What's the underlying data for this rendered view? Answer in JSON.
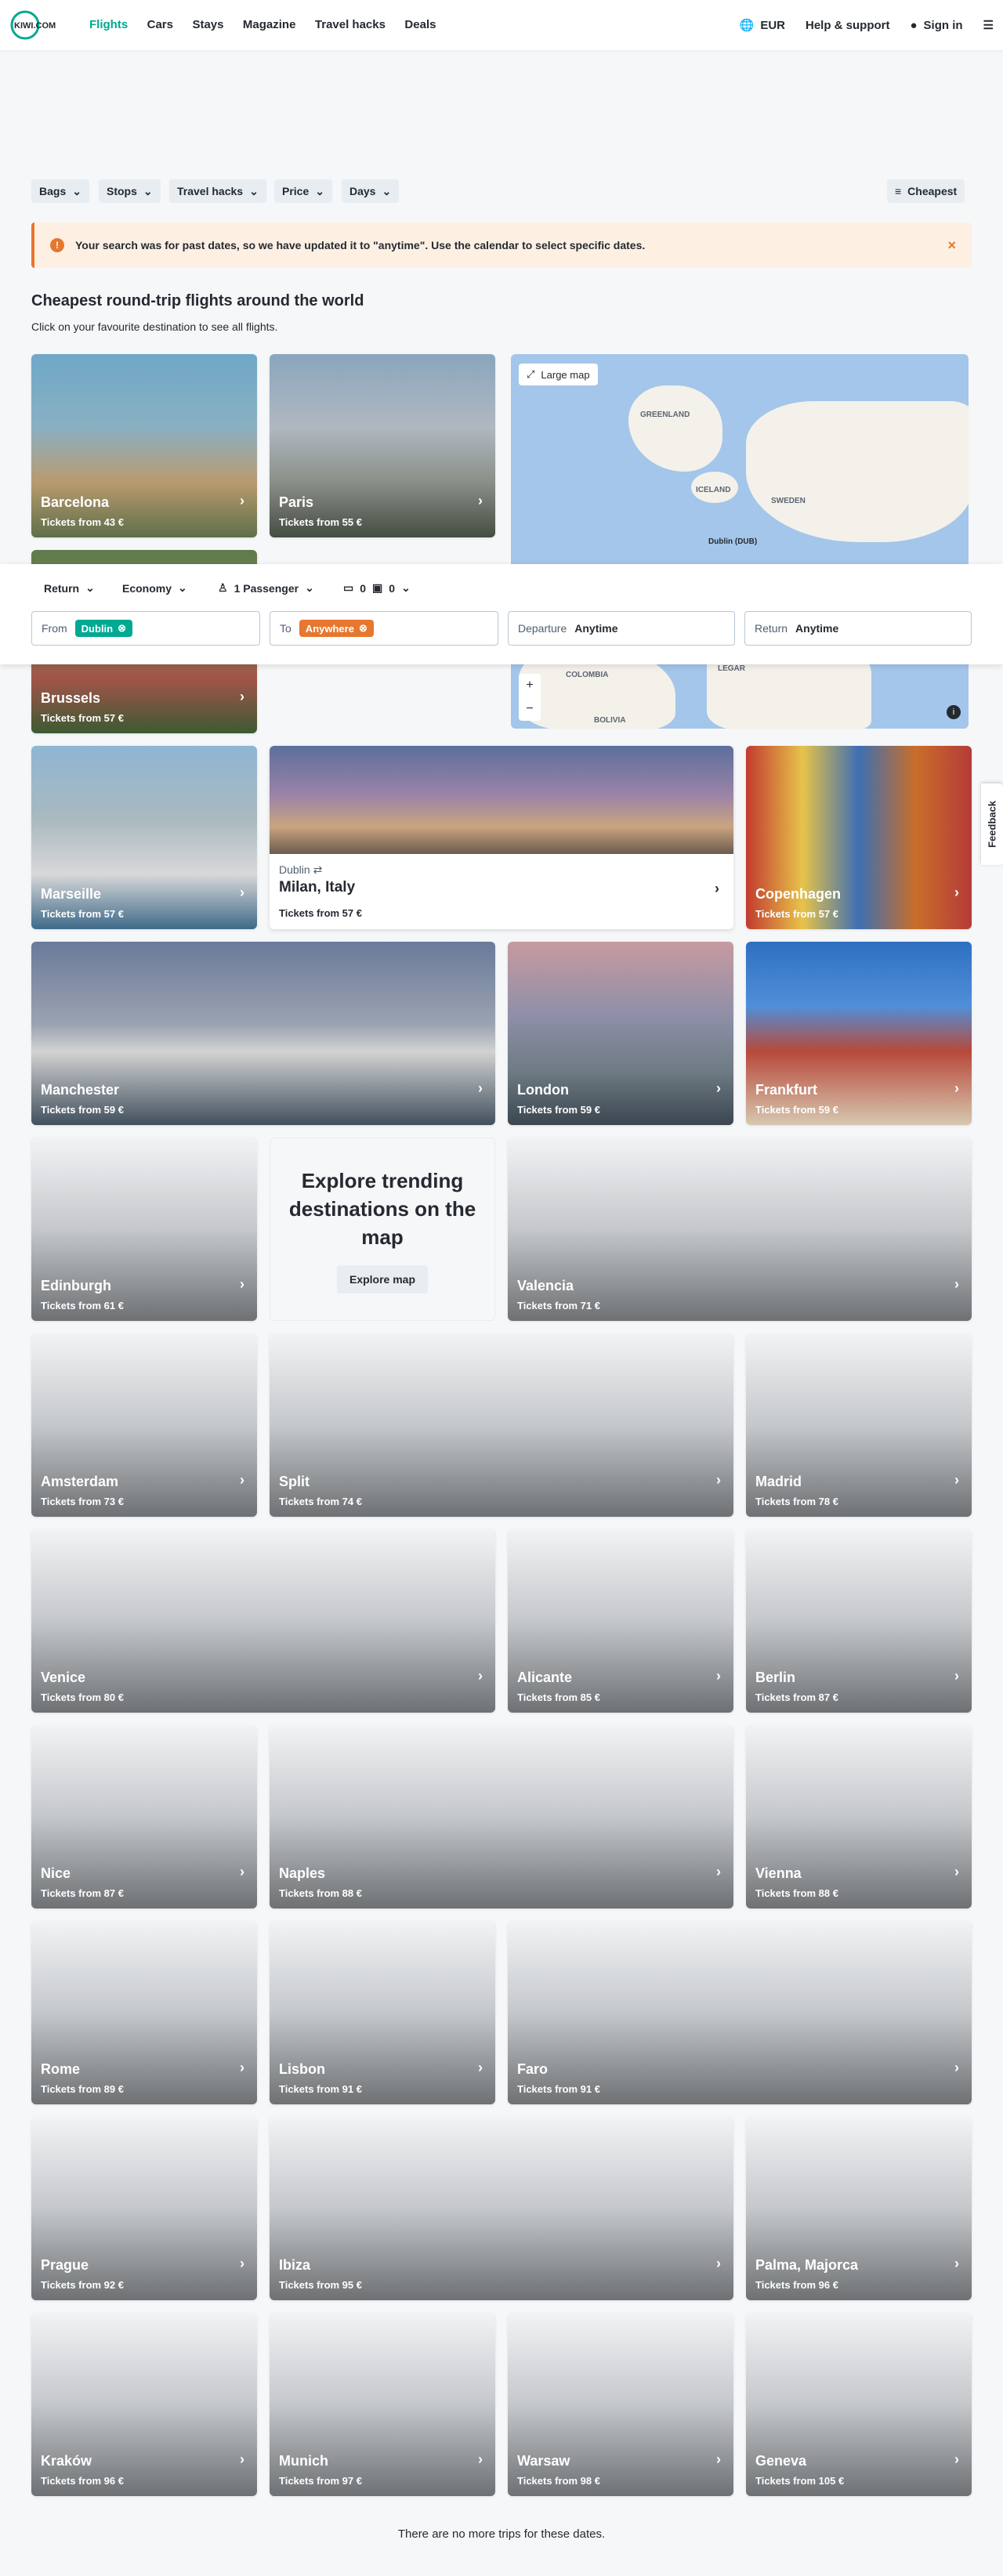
{
  "nav": {
    "logo_text": "KIWI.COM",
    "items": [
      "Flights",
      "Cars",
      "Stays",
      "Magazine",
      "Travel hacks",
      "Deals"
    ],
    "currency": "EUR",
    "help": "Help & support",
    "signin": "Sign in"
  },
  "filters": {
    "items": [
      "Bags",
      "Stops",
      "Travel hacks",
      "Price",
      "Days"
    ],
    "sort": "Cheapest"
  },
  "banner": {
    "text": "Your search was for past dates, so we have updated it to \"anytime\". Use the calendar to select specific dates."
  },
  "heading": "Cheapest round-trip flights around the world",
  "subheading": "Click on your favourite destination to see all flights.",
  "map": {
    "large_map": "Large map",
    "labels": [
      "GREENLAND",
      "ICELAND",
      "SWEDEN",
      "Dublin (DUB)",
      "COLOMBIA",
      "LEGAR",
      "BOLIVIA"
    ]
  },
  "search": {
    "trip_type": "Return",
    "cabin": "Economy",
    "passengers": "1 Passenger",
    "bags_cabin": "0",
    "bags_checked": "0",
    "from_label": "From",
    "from_value": "Dublin",
    "to_label": "To",
    "to_value": "Anywhere",
    "departure_label": "Departure",
    "departure_value": "Anytime",
    "return_label": "Return",
    "return_value": "Anytime"
  },
  "milan": {
    "origin": "Dublin",
    "city": "Milan, Italy",
    "price": "Tickets from 57 €"
  },
  "explore": {
    "title": "Explore trending destinations on the map",
    "button": "Explore map"
  },
  "feedback": "Feedback",
  "destinations": [
    {
      "name": "Barcelona",
      "price": "Tickets from 43 €"
    },
    {
      "name": "Paris",
      "price": "Tickets from 55 €"
    },
    {
      "name": "Brussels",
      "price": "Tickets from 57 €"
    },
    {
      "name": "Marseille",
      "price": "Tickets from 57 €"
    },
    {
      "name": "Copenhagen",
      "price": "Tickets from 57 €"
    },
    {
      "name": "Manchester",
      "price": "Tickets from 59 €"
    },
    {
      "name": "London",
      "price": "Tickets from 59 €"
    },
    {
      "name": "Frankfurt",
      "price": "Tickets from 59 €"
    },
    {
      "name": "Edinburgh",
      "price": "Tickets from 61 €"
    },
    {
      "name": "Valencia",
      "price": "Tickets from 71 €"
    },
    {
      "name": "Amsterdam",
      "price": "Tickets from 73 €"
    },
    {
      "name": "Split",
      "price": "Tickets from 74 €"
    },
    {
      "name": "Madrid",
      "price": "Tickets from 78 €"
    },
    {
      "name": "Venice",
      "price": "Tickets from 80 €"
    },
    {
      "name": "Alicante",
      "price": "Tickets from 85 €"
    },
    {
      "name": "Berlin",
      "price": "Tickets from 87 €"
    },
    {
      "name": "Nice",
      "price": "Tickets from 87 €"
    },
    {
      "name": "Naples",
      "price": "Tickets from 88 €"
    },
    {
      "name": "Vienna",
      "price": "Tickets from 88 €"
    },
    {
      "name": "Rome",
      "price": "Tickets from 89 €"
    },
    {
      "name": "Lisbon",
      "price": "Tickets from 91 €"
    },
    {
      "name": "Faro",
      "price": "Tickets from 91 €"
    },
    {
      "name": "Prague",
      "price": "Tickets from 92 €"
    },
    {
      "name": "Ibiza",
      "price": "Tickets from 95 €"
    },
    {
      "name": "Palma, Majorca",
      "price": "Tickets from 96 €"
    },
    {
      "name": "Kraków",
      "price": "Tickets from 96 €"
    },
    {
      "name": "Munich",
      "price": "Tickets from 97 €"
    },
    {
      "name": "Warsaw",
      "price": "Tickets from 98 €"
    },
    {
      "name": "Geneva",
      "price": "Tickets from 105 €"
    }
  ],
  "end_text": "There are no more trips for these dates."
}
